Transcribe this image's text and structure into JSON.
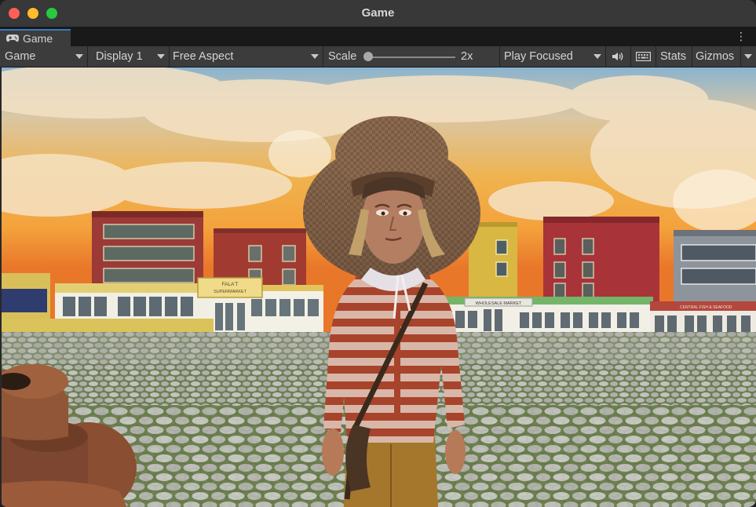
{
  "window": {
    "title": "Game"
  },
  "tab": {
    "label": "Game",
    "icon": "gamepad-icon"
  },
  "toolbar": {
    "view_dropdown": "Game",
    "display_dropdown": "Display 1",
    "aspect_dropdown": "Free Aspect",
    "scale_label": "Scale",
    "scale_value": "2x",
    "scale_fraction": 0,
    "play_mode_dropdown": "Play Focused",
    "audio_icon": "speaker-icon",
    "keyboard_icon": "keyboard-icon",
    "stats_label": "Stats",
    "gizmos_label": "Gizmos"
  },
  "scene": {
    "signs": [
      "FALA'T",
      "SUPERMARKET",
      "WHOLESALE MARKET",
      "CENTRAL FISH & SEAFOOD"
    ]
  },
  "colors": {
    "accent": "#3a79bb",
    "close": "#fe5f57",
    "minimize": "#febc2e",
    "maximize": "#28c840"
  }
}
